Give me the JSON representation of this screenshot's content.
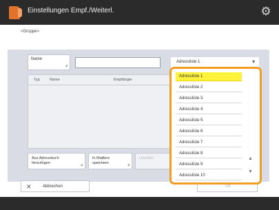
{
  "title": "Einstellungen Empf./Weiterl.",
  "icons": {
    "app": "app-icon",
    "settings": "gear-icon",
    "cancel": "close-icon",
    "dropdown": "chevron-down-icon"
  },
  "breadcrumb": "<Gruppe>",
  "name_button": {
    "label": "Name"
  },
  "select": {
    "value": "Adressliste 1"
  },
  "table": {
    "col_type": "Typ",
    "col_name": "Name",
    "col_recipient": "Empfänger"
  },
  "buttons": {
    "add_from_addressbook": "Aus Adressbuch hinzufügen",
    "save_mailbox": "In Mailbox speichern",
    "delete": "Löschen",
    "cancel": "Abbrechen",
    "ok": "OK"
  },
  "dropdown": {
    "items": [
      "Adressliste 1",
      "Adressliste 2",
      "Adressliste 3",
      "Adressliste 4",
      "Adressliste 5",
      "Adressliste 6",
      "Adressliste 7",
      "Adressliste 8",
      "Adressliste 9",
      "Adressliste 10"
    ],
    "selected_index": 0
  },
  "colors": {
    "accent": "#f39c23",
    "selected": "#fff23a",
    "titlebar": "#2b2b2b",
    "panel": "#d9dce4"
  }
}
